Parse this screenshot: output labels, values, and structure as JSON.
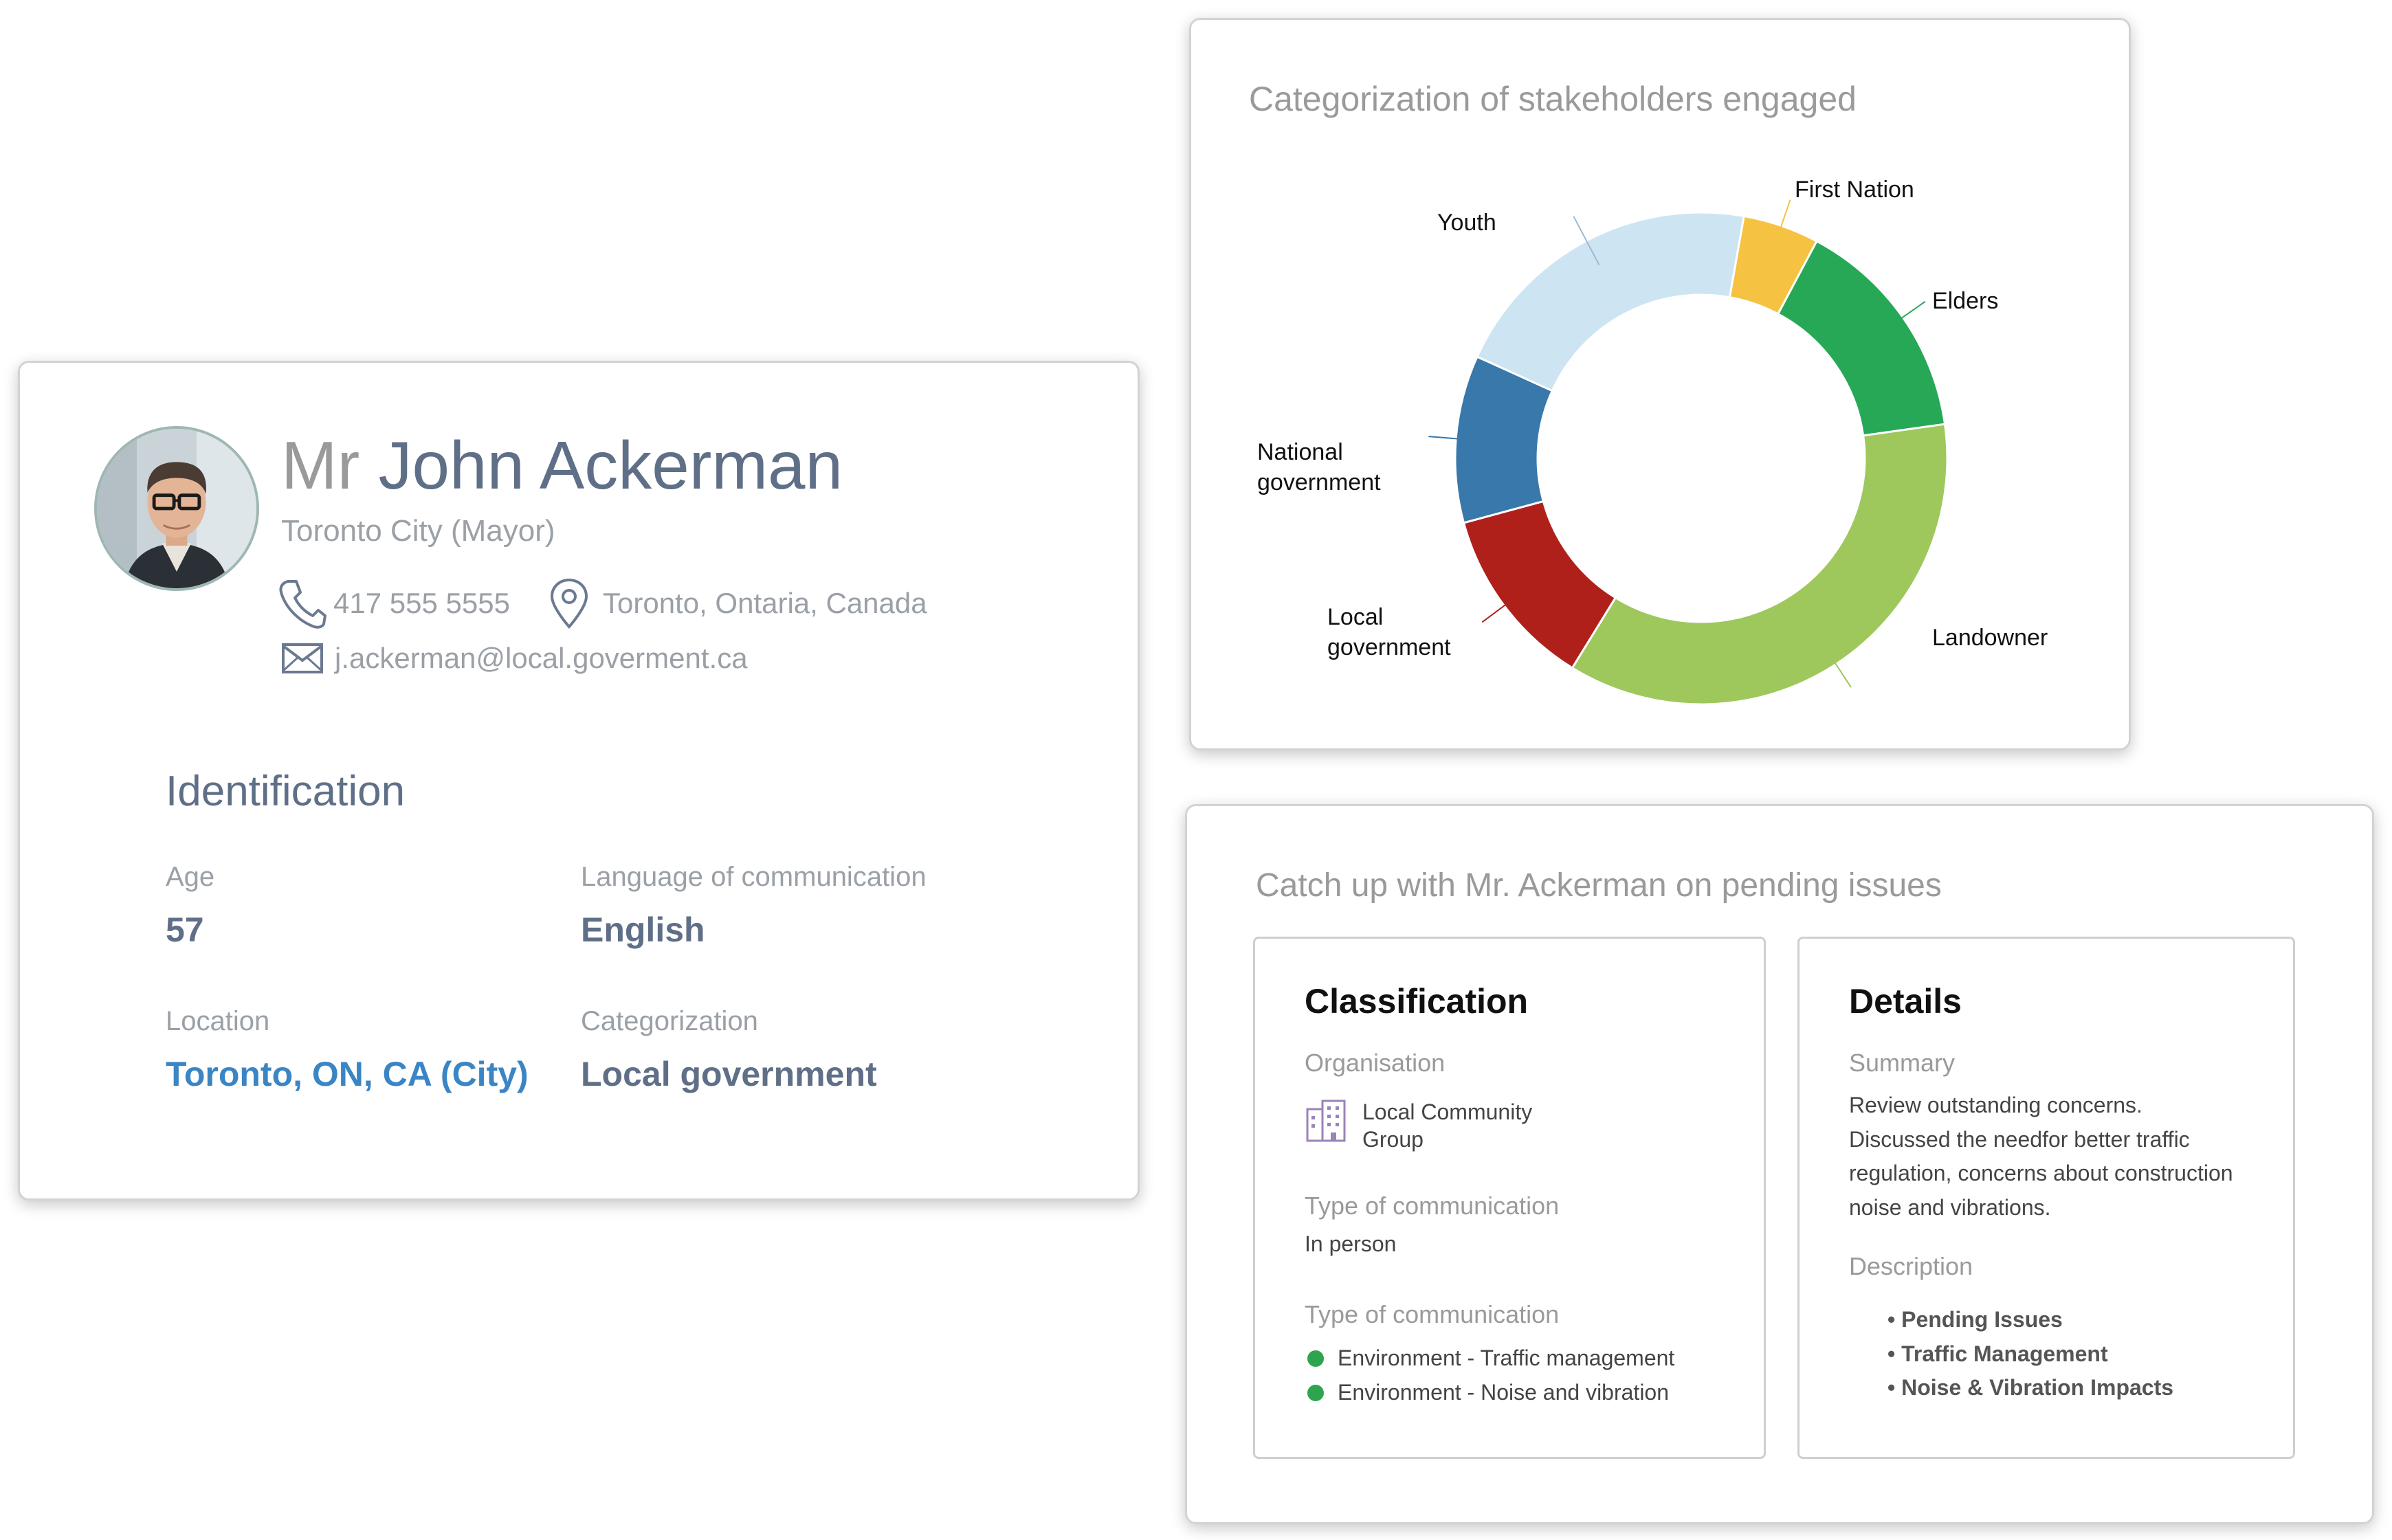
{
  "profile": {
    "salutation": "Mr",
    "name": "John Ackerman",
    "role": "Toronto City (Mayor)",
    "phone": "417 555 5555",
    "location": "Toronto, Ontaria, Canada",
    "email": "j.ackerman@local.goverment.ca",
    "identification_title": "Identification",
    "fields": {
      "age_label": "Age",
      "age_value": "57",
      "language_label": "Language of communication",
      "language_value": "English",
      "location_label": "Location",
      "location_value": "Toronto, ON, CA (City)",
      "categorization_label": "Categorization",
      "categorization_value": "Local government"
    },
    "icons": [
      "phone-icon",
      "map-pin-icon",
      "mail-icon"
    ],
    "colors": {
      "name": "#5f6f87",
      "link": "#3a85c4",
      "muted": "#9aa0a6"
    }
  },
  "chart_data": {
    "type": "pie",
    "title": "Categorization of stakeholders engaged",
    "donut": true,
    "slices": [
      {
        "label": "First Nation",
        "value": 5,
        "color": "#f5c242"
      },
      {
        "label": "Elders",
        "value": 15,
        "color": "#27a857"
      },
      {
        "label": "Landowner",
        "value": 36,
        "color": "#9ec85c"
      },
      {
        "label": "Local government",
        "value": 12,
        "color": "#b0201a"
      },
      {
        "label": "National government",
        "value": 11,
        "color": "#3878aa"
      },
      {
        "label": "Youth",
        "value": 21,
        "color": "#cde4f2"
      }
    ]
  },
  "issues": {
    "title": "Catch up with Mr. Ackerman on pending issues",
    "classification": {
      "heading": "Classification",
      "organisation_label": "Organisation",
      "organisation_value": "Local Community Group",
      "comm_type_label": "Type of communication",
      "comm_type_value": "In person",
      "topics_label": "Type of communication",
      "topics": [
        "Environment - Traffic management",
        "Environment - Noise and vibration"
      ],
      "topic_dot_color": "#2fa44f",
      "org_icon": "building-icon"
    },
    "details": {
      "heading": "Details",
      "summary_label": "Summary",
      "summary_text": "Review outstanding concerns. Discussed the needfor better traffic regulation, concerns about construction noise and vibrations.",
      "description_label": "Description",
      "description_items": [
        "Pending Issues",
        "Traffic Management",
        "Noise & Vibration Impacts"
      ]
    }
  }
}
